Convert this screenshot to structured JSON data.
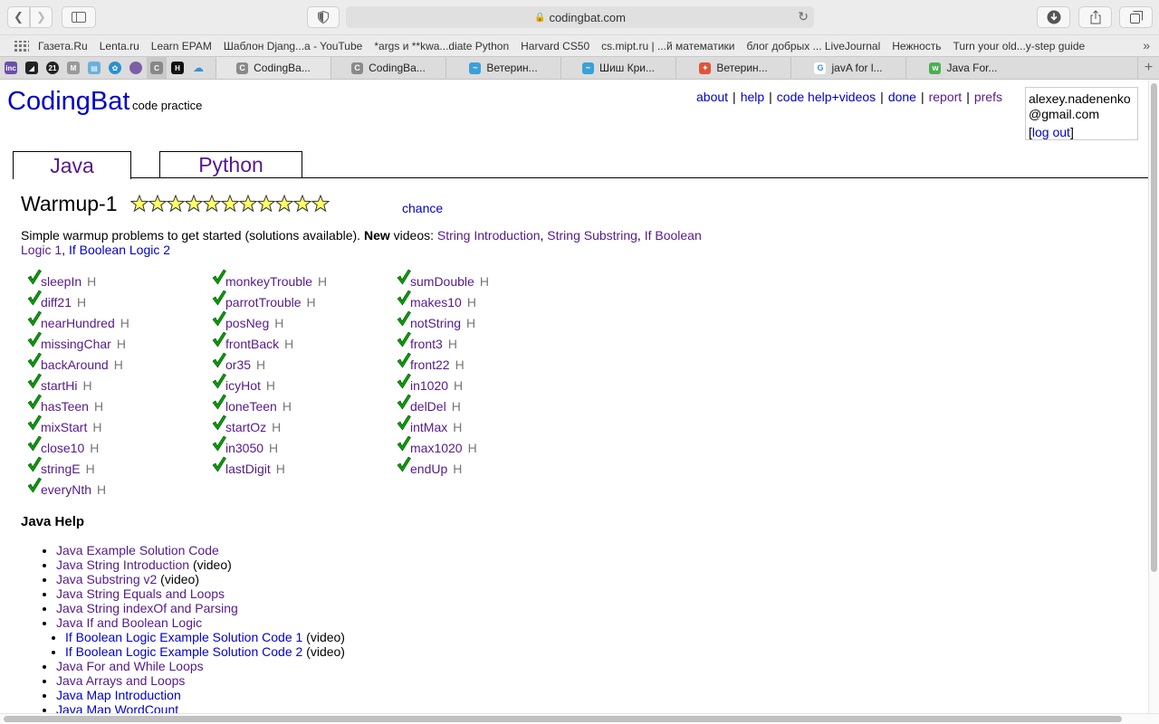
{
  "browser": {
    "url": "codingbat.com",
    "bookmarks": [
      "Газета.Ru",
      "Lenta.ru",
      "Learn EPAM",
      "Шаблон Djang...a - YouTube",
      "*args и **kwa...diate Python",
      "Harvard CS50",
      "cs.mipt.ru | ...й математики",
      "блог добрых ... LiveJournal",
      "Нежность",
      "Turn your old...y-step guide"
    ],
    "tabs": [
      {
        "label": "CodingBa...",
        "icon_color": "#8a8a8a"
      },
      {
        "label": "CodingBa...",
        "icon_color": "#8a8a8a"
      },
      {
        "label": "Ветерин...",
        "icon_color": "#3aa0d8"
      },
      {
        "label": "Шиш Кри...",
        "icon_color": "#3aa0d8"
      },
      {
        "label": "Ветерин...",
        "icon_color": "#e0553a"
      },
      {
        "label": "javA for l...",
        "icon_color": "#4285f4"
      },
      {
        "label": "Java For...",
        "icon_color": "#4caf50"
      }
    ]
  },
  "site": {
    "logo": "CodingBat",
    "logo_sub": "code practice",
    "nav": [
      "about",
      "help",
      "code help+videos",
      "done",
      "report",
      "prefs"
    ],
    "user_email_1": "alexey.nadenenko",
    "user_email_2": "@gmail.com",
    "logout": "log out",
    "lang_tabs": [
      "Java",
      "Python"
    ]
  },
  "section": {
    "title": "Warmup-1",
    "star_count": 11,
    "chance": "chance",
    "desc_text": "Simple warmup problems to get started (solutions available). ",
    "desc_new": "New",
    "desc_videos": " videos: ",
    "video_links": [
      "String Introduction",
      "String Substring",
      "If Boolean Logic 1",
      "If Boolean Logic 2"
    ]
  },
  "problems": {
    "col1": [
      "sleepIn",
      "diff21",
      "nearHundred",
      "missingChar",
      "backAround",
      "startHi",
      "hasTeen",
      "mixStart",
      "close10",
      "stringE",
      "everyNth"
    ],
    "col2": [
      "monkeyTrouble",
      "parrotTrouble",
      "posNeg",
      "frontBack",
      "or35",
      "icyHot",
      "loneTeen",
      "startOz",
      "in3050",
      "lastDigit"
    ],
    "col3": [
      "sumDouble",
      "makes10",
      "notString",
      "front3",
      "front22",
      "in1020",
      "delDel",
      "intMax",
      "max1020",
      "endUp"
    ],
    "hint": "H"
  },
  "help": {
    "title": "Java Help",
    "items": [
      {
        "label": "Java Example Solution Code",
        "suffix": "",
        "sub": false,
        "visited": true
      },
      {
        "label": "Java String Introduction",
        "suffix": " (video)",
        "sub": false,
        "visited": true
      },
      {
        "label": "Java Substring v2",
        "suffix": " (video)",
        "sub": false,
        "visited": true
      },
      {
        "label": "Java String Equals and Loops",
        "suffix": "",
        "sub": false,
        "visited": true
      },
      {
        "label": "Java String indexOf and Parsing",
        "suffix": "",
        "sub": false,
        "visited": true
      },
      {
        "label": "Java If and Boolean Logic",
        "suffix": "",
        "sub": false,
        "visited": true
      },
      {
        "label": "If Boolean Logic Example Solution Code 1",
        "suffix": " (video)",
        "sub": true,
        "visited": false
      },
      {
        "label": "If Boolean Logic Example Solution Code 2",
        "suffix": " (video)",
        "sub": true,
        "visited": false
      },
      {
        "label": "Java For and While Loops",
        "suffix": "",
        "sub": false,
        "visited": true
      },
      {
        "label": "Java Arrays and Loops",
        "suffix": "",
        "sub": false,
        "visited": true
      },
      {
        "label": "Java Map Introduction",
        "suffix": "",
        "sub": false,
        "visited": false
      },
      {
        "label": "Java Map WordCount",
        "suffix": "",
        "sub": false,
        "visited": false
      }
    ]
  },
  "colors": {
    "link": "#0000cc",
    "visited": "#551a8b",
    "check": "#00a000",
    "star": "#ffff66"
  }
}
